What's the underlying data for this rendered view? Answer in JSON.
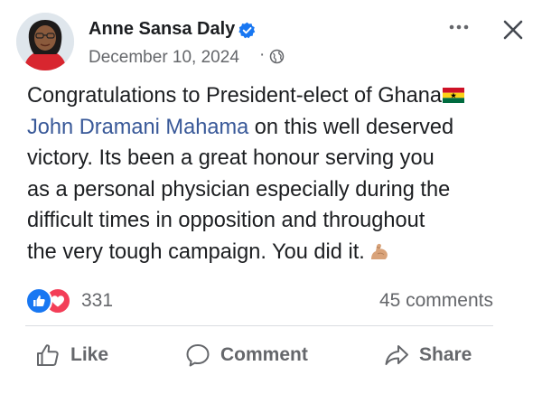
{
  "post": {
    "author": {
      "name": "Anne Sansa Daly",
      "verified": true,
      "verified_icon": "verified-badge-icon",
      "avatar": "profile-photo"
    },
    "date": "December 10, 2024",
    "date_separator": "·",
    "audience_icon": "globe-icon",
    "menu_icon": "more-options-icon",
    "close_icon": "close-icon",
    "text_lines": [
      {
        "before": "Congratulations to President-elect of Ghana",
        "emoji": "ghana-flag"
      },
      {
        "mention": "John Dramani Mahama",
        "after": " on this well deserved"
      },
      {
        "text": "victory. Its been a great honour serving you"
      },
      {
        "text": "as a personal physician especially during the"
      },
      {
        "text": "difficult times in opposition and throughout"
      },
      {
        "before": "the very tough campaign. You did it.",
        "emoji": "flexed-biceps"
      }
    ],
    "reactions": {
      "types": [
        "like",
        "love"
      ],
      "count": "331"
    },
    "comments_count": "45 comments",
    "actions": {
      "like": "Like",
      "comment": "Comment",
      "share": "Share"
    },
    "colors": {
      "text": "#1c1e21",
      "secondary": "#65676b",
      "mention": "#385898",
      "like_blue": "#1877f2",
      "love_red": "#f33e58",
      "verified_blue": "#1877f2"
    }
  }
}
